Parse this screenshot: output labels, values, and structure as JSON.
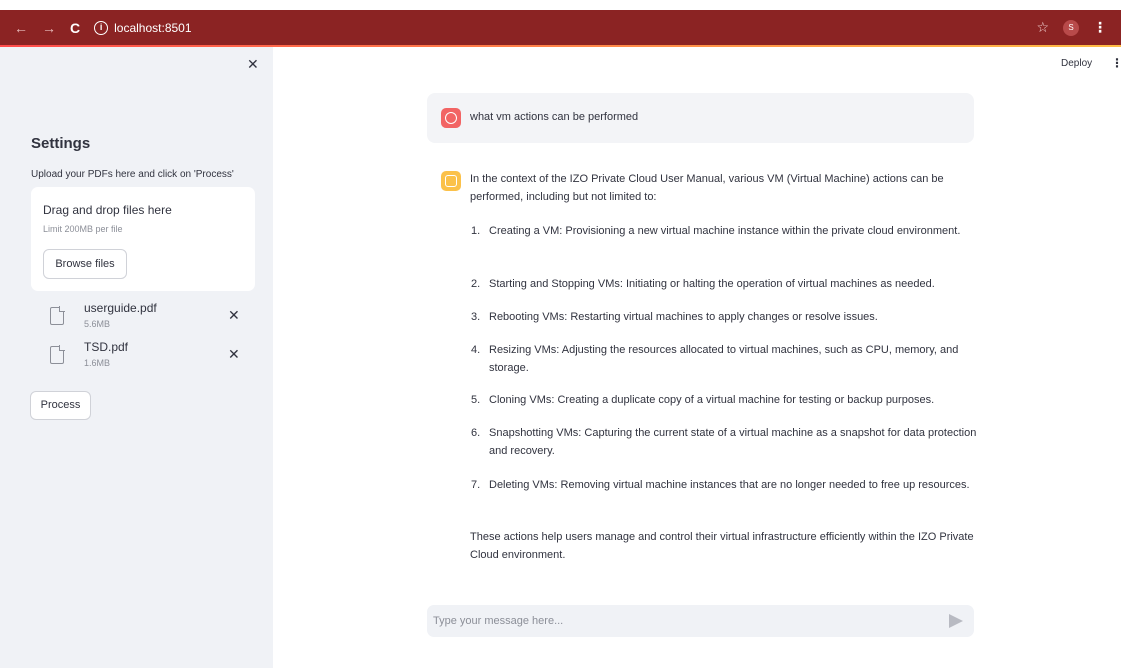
{
  "browser": {
    "back_icon": "←",
    "forward_icon": "→",
    "reload_icon": "C",
    "info_icon": "i",
    "url": "localhost:8501",
    "star_icon": "☆",
    "profile_initial": "S",
    "menu_icon": "⋮"
  },
  "sidebar": {
    "close_icon": "✕",
    "title": "Settings",
    "upload_label": "Upload your PDFs here and click on 'Process'",
    "dropzone": {
      "title": "Drag and drop files here",
      "limit": "Limit 200MB per file",
      "browse_label": "Browse files"
    },
    "files": [
      {
        "name": "userguide.pdf",
        "size": "5.6MB"
      },
      {
        "name": "TSD.pdf",
        "size": "1.6MB"
      }
    ],
    "remove_icon": "✕",
    "process_label": "Process"
  },
  "header": {
    "deploy_label": "Deploy",
    "menu_icon": "⋮"
  },
  "chat": {
    "user_message": "what vm actions can be performed",
    "assistant": {
      "intro": "In the context of the IZO Private Cloud User Manual, various VM (Virtual Machine) actions can be performed, including but not limited to:",
      "items": [
        {
          "num": "1.",
          "text": "Creating a VM: Provisioning a new virtual machine instance within the private cloud environment."
        },
        {
          "num": "2.",
          "text": "Starting and Stopping VMs: Initiating or halting the operation of virtual machines as needed."
        },
        {
          "num": "3.",
          "text": "Rebooting VMs: Restarting virtual machines to apply changes or resolve issues."
        },
        {
          "num": "4.",
          "text": "Resizing VMs: Adjusting the resources allocated to virtual machines, such as CPU, memory, and storage."
        },
        {
          "num": "5.",
          "text": "Cloning VMs: Creating a duplicate copy of a virtual machine for testing or backup purposes."
        },
        {
          "num": "6.",
          "text": "Snapshotting VMs: Capturing the current state of a virtual machine as a snapshot for data protection and recovery."
        },
        {
          "num": "7.",
          "text": "Deleting VMs: Removing virtual machine instances that are no longer needed to free up resources."
        }
      ],
      "closing": "These actions help users manage and control their virtual infrastructure efficiently within the IZO Private Cloud environment."
    },
    "input_placeholder": "Type your message here..."
  },
  "colors": {
    "browser_bar": "#8b2323",
    "sidebar_bg": "#f0f2f6",
    "user_avatar": "#f26464",
    "assistant_avatar": "#fbc14a"
  }
}
